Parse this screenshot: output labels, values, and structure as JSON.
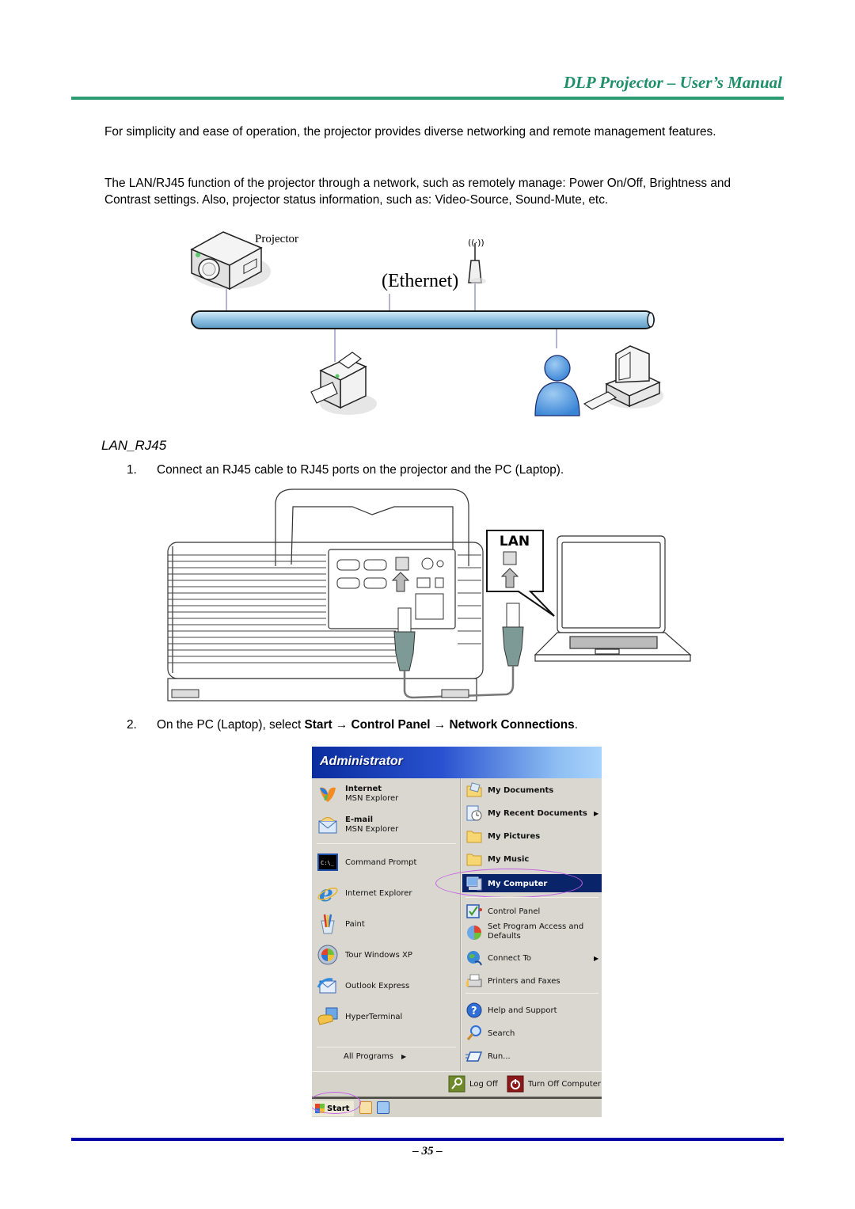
{
  "header": {
    "title": "DLP Projector – User’s Manual"
  },
  "intro": {
    "paragraph1": "For simplicity and ease of operation, the projector provides diverse networking and remote management features.",
    "paragraph2": "The LAN/RJ45 function of the projector through a network, such as remotely manage: Power On/Off, Brightness and Contrast settings. Also, projector status information, such as: Video-Source, Sound-Mute, etc."
  },
  "network_diagram": {
    "projector_label": "Projector",
    "network_label": "(Ethernet)",
    "devices": [
      "projector-icon",
      "wireless-access-point-icon",
      "printer-icon",
      "user-icon",
      "desktop-computer-icon"
    ]
  },
  "section": {
    "heading": "LAN_RJ45"
  },
  "steps": [
    {
      "number": "1.",
      "text": "Connect an RJ45 cable to RJ45 ports on the projector and the PC (Laptop)."
    },
    {
      "number": "2.",
      "text_prefix": "On the PC (Laptop), select ",
      "start": "Start",
      "arrow": "→",
      "control_panel": "Control Panel",
      "network_connections": "Network Connections",
      "suffix": "."
    }
  ],
  "hardware_diagram": {
    "lan_label": "LAN"
  },
  "start_menu": {
    "user": "Administrator",
    "pinned": [
      {
        "title": "Internet",
        "subtitle": "MSN Explorer",
        "icon": "msn-butterfly-icon"
      },
      {
        "title": "E-mail",
        "subtitle": "MSN Explorer",
        "icon": "mail-envelope-icon"
      }
    ],
    "recent": [
      {
        "label": "Command Prompt",
        "icon": "command-prompt-icon"
      },
      {
        "label": "Internet Explorer",
        "icon": "internet-explorer-icon"
      },
      {
        "label": "Paint",
        "icon": "paint-icon"
      },
      {
        "label": "Tour Windows XP",
        "icon": "tour-windows-icon"
      },
      {
        "label": "Outlook Express",
        "icon": "outlook-express-icon"
      },
      {
        "label": "HyperTerminal",
        "icon": "hyperterminal-icon"
      }
    ],
    "all_programs": "All Programs",
    "places": [
      {
        "label": "My Documents",
        "icon": "folder-documents-icon"
      },
      {
        "label": "My Recent Documents",
        "icon": "recent-documents-icon",
        "submenu": true
      },
      {
        "label": "My Pictures",
        "icon": "folder-icon"
      },
      {
        "label": "My Music",
        "icon": "folder-icon"
      },
      {
        "label": "My Computer",
        "icon": "my-computer-icon",
        "selected": true
      }
    ],
    "system": [
      {
        "label": "Control Panel",
        "icon": "control-panel-icon"
      },
      {
        "label": "Set Program Access and",
        "label2": "Defaults",
        "icon": "program-access-icon"
      },
      {
        "label": "Connect To",
        "icon": "connect-to-icon",
        "submenu": true
      },
      {
        "label": "Printers and Faxes",
        "icon": "printer-icon"
      }
    ],
    "help": [
      {
        "label": "Help and Support",
        "icon": "help-icon"
      },
      {
        "label": "Search",
        "icon": "search-icon"
      },
      {
        "label": "Run...",
        "icon": "run-icon"
      }
    ],
    "log_off": "Log Off",
    "turn_off": "Turn Off Computer",
    "start_button": "Start"
  },
  "footer": {
    "page_number": "– 35 –"
  },
  "colors": {
    "header_green": "#1f8f68",
    "footer_blue": "#0000a8",
    "menu_selection": "#0a246a",
    "highlight_ellipse": "#c560e8"
  }
}
